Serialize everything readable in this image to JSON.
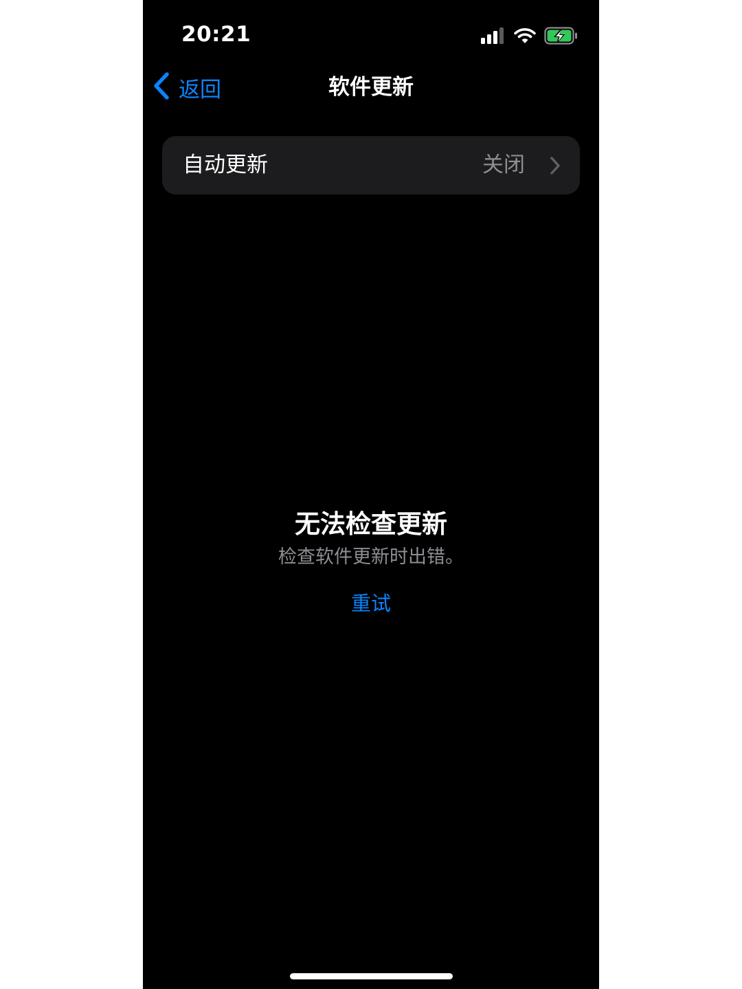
{
  "status_bar": {
    "time": "20:21",
    "icons": [
      "cellular-signal-icon",
      "wifi-icon",
      "battery-charging-icon"
    ]
  },
  "nav": {
    "back_label": "返回",
    "back_icon": "chevron-left-icon",
    "title": "软件更新"
  },
  "settings": {
    "auto_update": {
      "label": "自动更新",
      "value": "关闭",
      "icon": "chevron-right-icon"
    }
  },
  "error": {
    "title": "无法检查更新",
    "message": "检查软件更新时出错。",
    "retry_label": "重试"
  },
  "colors": {
    "background": "#000000",
    "accent": "#0a84ff",
    "cell_background": "#1c1c1e",
    "secondary_text": "#8d8d93",
    "battery_charge": "#34c759"
  }
}
